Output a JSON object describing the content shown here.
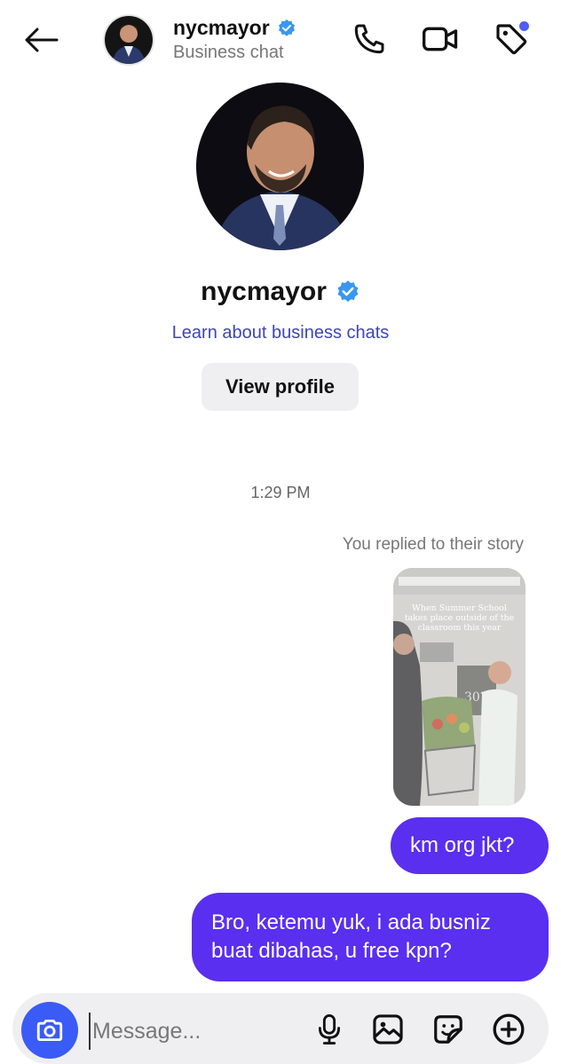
{
  "header": {
    "name": "nycmayor",
    "subtitle": "Business chat"
  },
  "profile": {
    "name": "nycmayor",
    "learn_link": "Learn about business chats",
    "view_profile_label": "View profile"
  },
  "conversation": {
    "timestamp": "1:29 PM",
    "story_reply_note": "You replied to their story",
    "story_caption": "When Summer School takes place outside of the classroom this year",
    "messages": [
      "km org jkt?",
      "Bro, ketemu yuk, i ada busniz buat dibahas, u free kpn?"
    ]
  },
  "composer": {
    "placeholder": "Message..."
  },
  "colors": {
    "accent": "#5a2ff0",
    "camera_button": "#3b5bf6",
    "verified": "#3897f0",
    "link": "#3d45b8"
  }
}
